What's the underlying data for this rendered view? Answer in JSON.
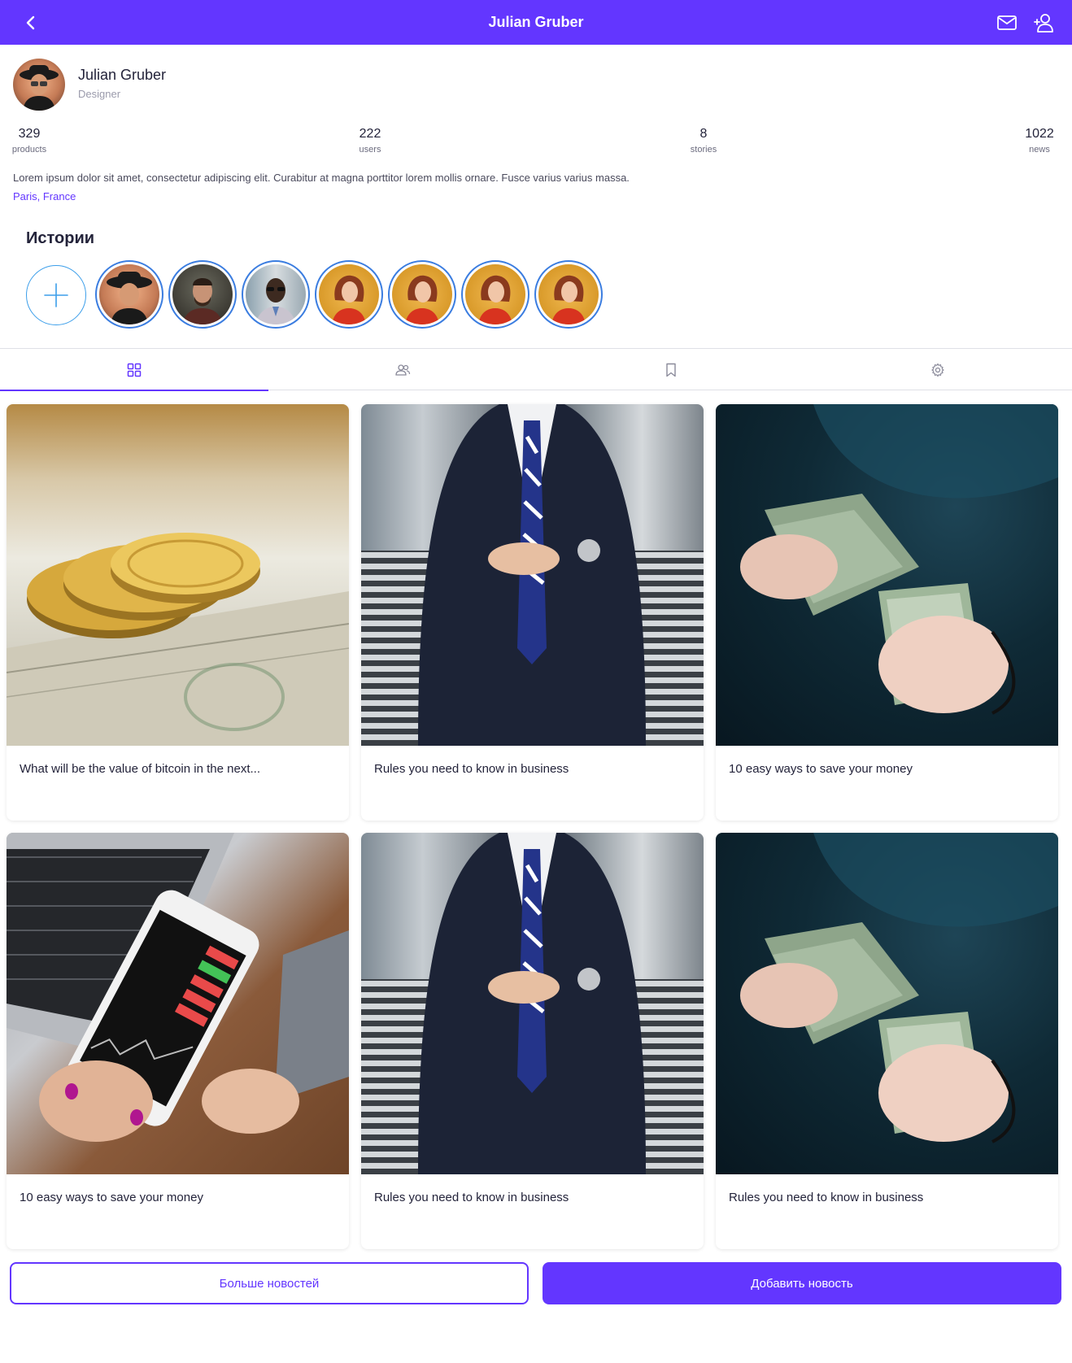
{
  "header": {
    "title": "Julian Gruber",
    "background_color": "#6336ff",
    "icons": [
      "back-arrow-icon",
      "mail-icon",
      "add-user-icon"
    ]
  },
  "profile": {
    "name": "Julian Gruber",
    "role": "Designer",
    "stats": [
      {
        "value": "329",
        "label": "products"
      },
      {
        "value": "222",
        "label": "users"
      },
      {
        "value": "8",
        "label": "stories"
      },
      {
        "value": "1022",
        "label": "news"
      }
    ],
    "bio": "Lorem ipsum dolor sit amet, consectetur adipiscing elit. Curabitur at magna porttitor lorem mollis ornare. Fusce varius varius massa.",
    "location": "Paris, France"
  },
  "stories": {
    "title": "Истории",
    "count": 8
  },
  "tabs": [
    {
      "icon": "grid-icon",
      "active": true
    },
    {
      "icon": "users-icon",
      "active": false
    },
    {
      "icon": "bookmark-icon",
      "active": false
    },
    {
      "icon": "settings-gear-icon",
      "active": false
    }
  ],
  "cards": [
    {
      "title": "What will be the value of bitcoin in the next..."
    },
    {
      "title": "Rules you need to know in business"
    },
    {
      "title": "10 easy ways to save your money"
    },
    {
      "title": "10 easy ways to save your money"
    },
    {
      "title": "Rules you need to know in business"
    },
    {
      "title": "Rules you need to know in business"
    }
  ],
  "buttons": {
    "more": "Больше новостей",
    "add": "Добавить новость"
  },
  "colors": {
    "accent": "#6336ff",
    "story_ring": "#3b7de0"
  }
}
